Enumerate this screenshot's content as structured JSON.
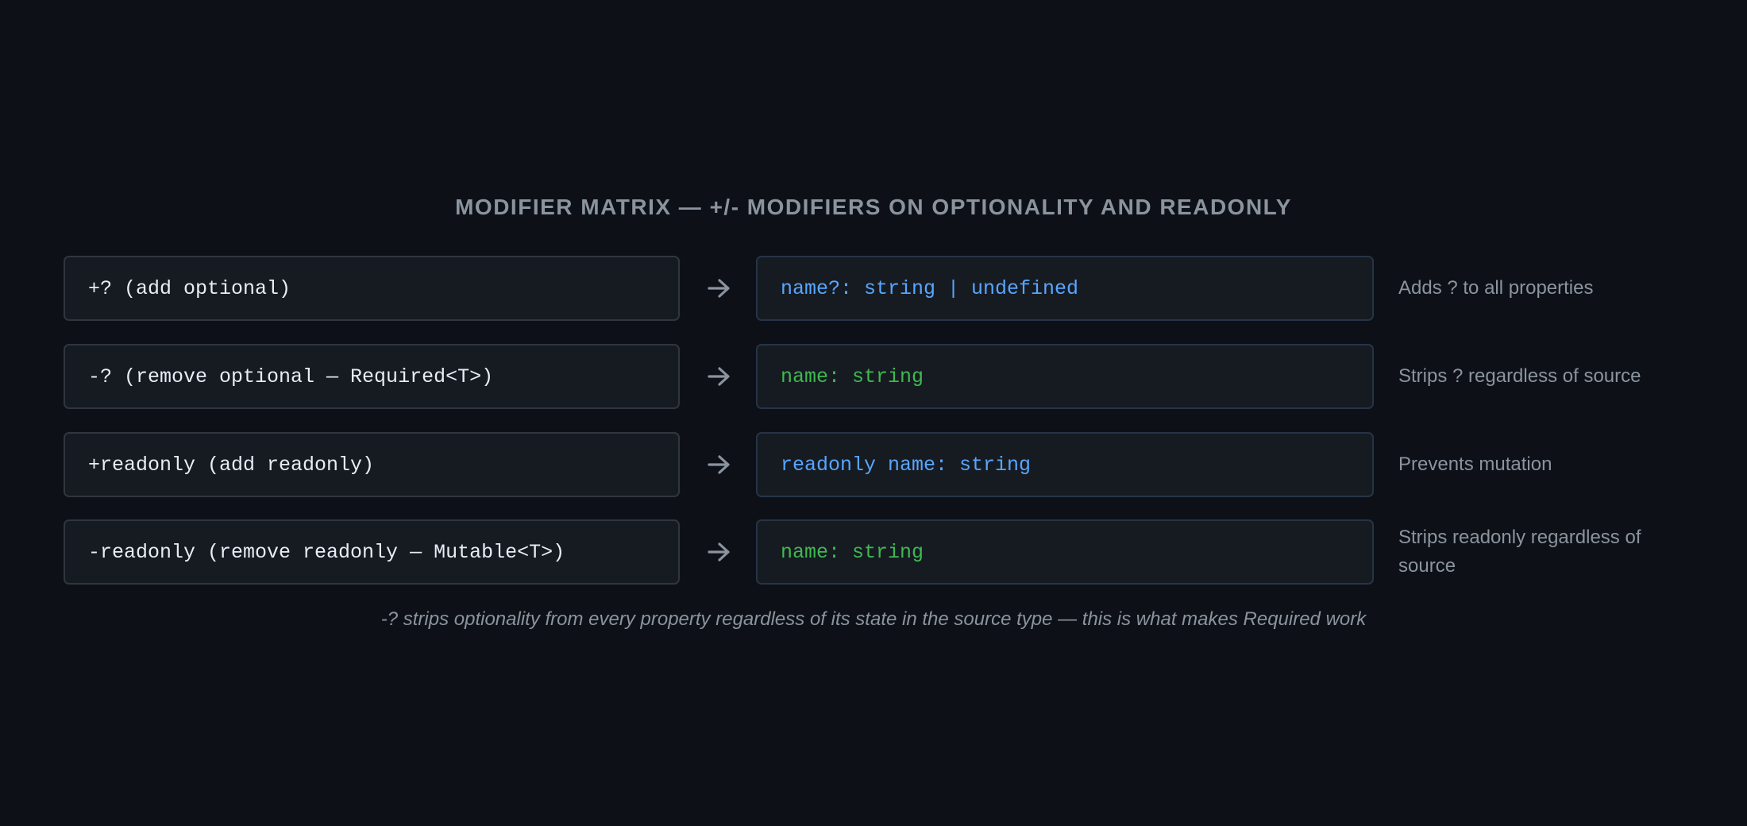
{
  "title": "MODIFIER MATRIX — +/- MODIFIERS ON OPTIONALITY AND READONLY",
  "rows": [
    {
      "modifier": "+? (add optional)",
      "result": "name?: string | undefined",
      "result_color": "#58a6ff",
      "note": "Adds ? to all properties"
    },
    {
      "modifier": "-? (remove optional — Required<T>)",
      "result": "name: string",
      "result_color": "#3fb950",
      "note": "Strips ? regardless of source"
    },
    {
      "modifier": "+readonly (add readonly)",
      "result": "readonly name: string",
      "result_color": "#58a6ff",
      "note": "Prevents mutation"
    },
    {
      "modifier": "-readonly (remove readonly — Mutable<T>)",
      "result": "name: string",
      "result_color": "#3fb950",
      "note": "Strips readonly regardless of source"
    }
  ],
  "footnote": "-? strips optionality from every property regardless of its state in the source type — this is what makes Required work",
  "colors": {
    "background": "#0d1117",
    "box_background": "#161b22",
    "box_border": "#30363d",
    "text_muted": "#8b949e",
    "code_default": "#e6edf3",
    "accent_blue": "#58a6ff",
    "accent_green": "#3fb950"
  }
}
